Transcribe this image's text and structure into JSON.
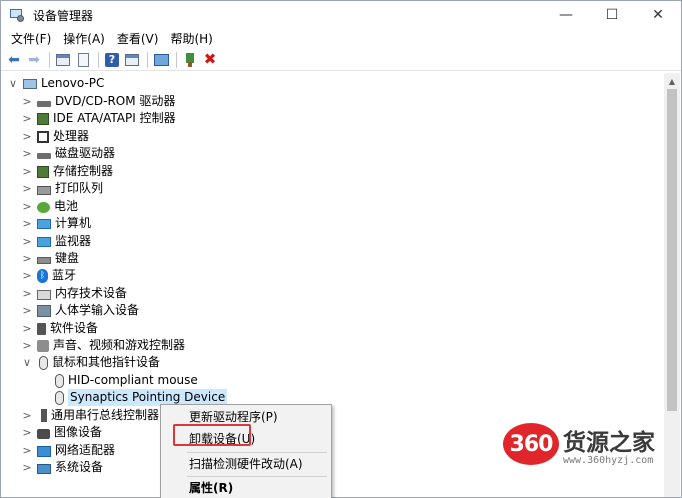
{
  "window": {
    "title": "设备管理器",
    "controls": {
      "minimize": "—",
      "maximize": "☐",
      "close": "✕"
    }
  },
  "menubar": [
    {
      "label": "文件(F)"
    },
    {
      "label": "操作(A)"
    },
    {
      "label": "查看(V)"
    },
    {
      "label": "帮助(H)"
    }
  ],
  "toolbar": {
    "icons": [
      "back-arrow-icon",
      "forward-arrow-icon",
      "show-hide-console-tree-icon",
      "properties-icon",
      "help-icon",
      "action-pane-icon",
      "scan-hardware-icon",
      "update-driver-icon",
      "uninstall-device-icon"
    ]
  },
  "tree": {
    "root": {
      "label": "Lenovo-PC",
      "expander": "∨"
    },
    "categories": [
      {
        "label": "DVD/CD-ROM 驱动器",
        "expander": ">"
      },
      {
        "label": "IDE ATA/ATAPI 控制器",
        "expander": ">"
      },
      {
        "label": "处理器",
        "expander": ">"
      },
      {
        "label": "磁盘驱动器",
        "expander": ">"
      },
      {
        "label": "存储控制器",
        "expander": ">"
      },
      {
        "label": "打印队列",
        "expander": ">"
      },
      {
        "label": "电池",
        "expander": ">"
      },
      {
        "label": "计算机",
        "expander": ">"
      },
      {
        "label": "监视器",
        "expander": ">"
      },
      {
        "label": "键盘",
        "expander": ">"
      },
      {
        "label": "蓝牙",
        "expander": ">"
      },
      {
        "label": "内存技术设备",
        "expander": ">"
      },
      {
        "label": "人体学输入设备",
        "expander": ">"
      },
      {
        "label": "软件设备",
        "expander": ">"
      },
      {
        "label": "声音、视频和游戏控制器",
        "expander": ">"
      },
      {
        "label": "鼠标和其他指针设备",
        "expander": "∨"
      }
    ],
    "mouse_children": [
      {
        "label": "HID-compliant mouse"
      },
      {
        "label": "Synaptics Pointing Device",
        "selected": true
      }
    ],
    "after_categories": [
      {
        "label": "通用串行总线控制器",
        "expander": ">"
      },
      {
        "label": "图像设备",
        "expander": ">"
      },
      {
        "label": "网络适配器",
        "expander": ">"
      },
      {
        "label": "系统设备",
        "expander": ">"
      }
    ]
  },
  "context_menu": {
    "items": [
      {
        "label": "更新驱动程序(P)"
      },
      {
        "label": "卸载设备(U)",
        "highlighted": true
      },
      {
        "label": "扫描检测硬件改动(A)"
      },
      {
        "label": "属性(R)",
        "bold": true
      }
    ]
  },
  "watermark": {
    "badge": "360",
    "text": "货源之家",
    "url": "www.360hyzj.com"
  },
  "colors": {
    "selection": "#cce8ff",
    "highlight_border": "#d9383a",
    "watermark_red": "#e0262b"
  }
}
